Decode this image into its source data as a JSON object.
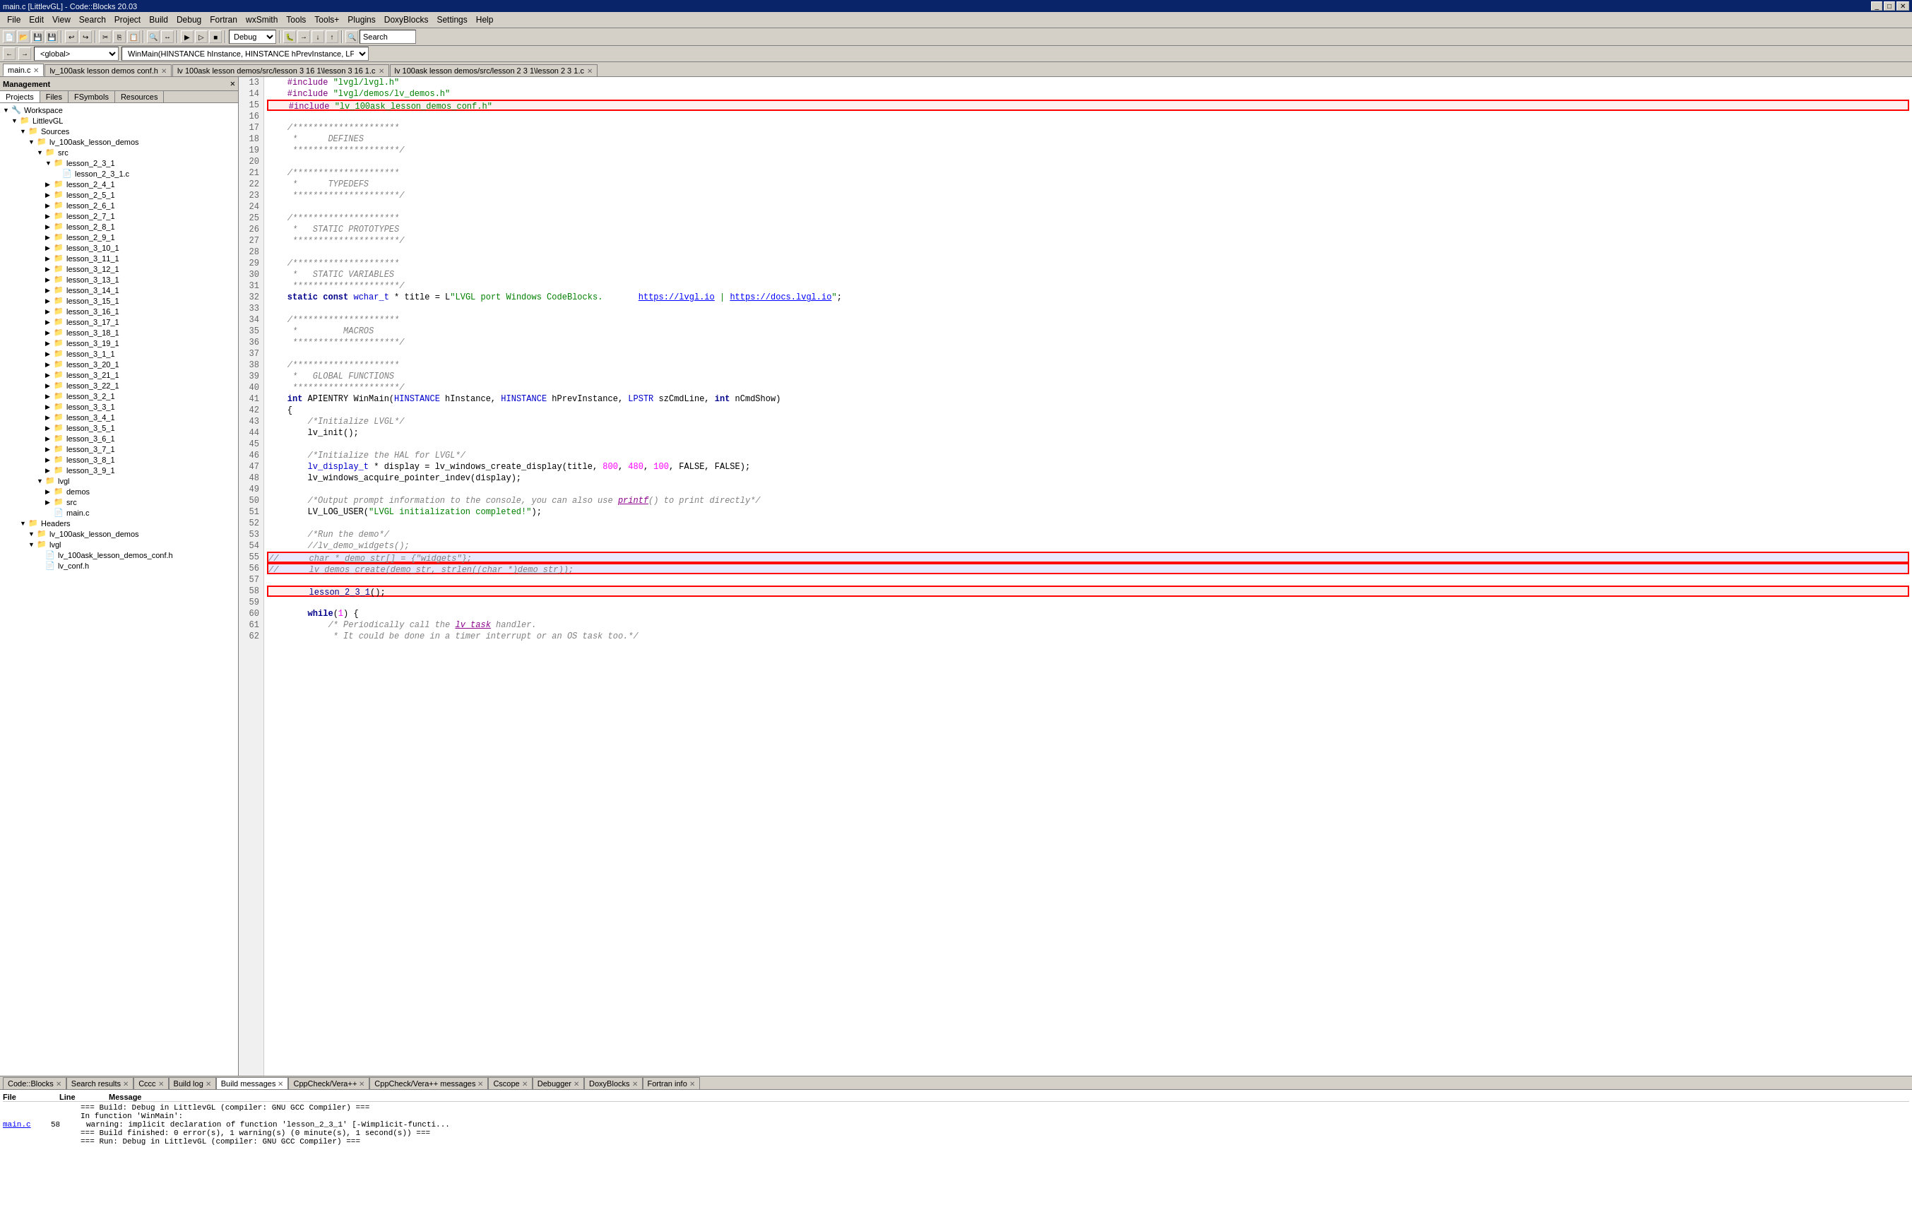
{
  "titleBar": {
    "title": "main.c [LittlevGL] - Code::Blocks 20.03",
    "controls": [
      "_",
      "□",
      "✕"
    ]
  },
  "menuBar": {
    "items": [
      "File",
      "Edit",
      "View",
      "Search",
      "Project",
      "Build",
      "Debug",
      "Fortran",
      "wxSmith",
      "Tools",
      "Tools+",
      "Plugins",
      "DoxyBlocks",
      "Settings",
      "Help"
    ]
  },
  "toolbar": {
    "buildConfig": "Debug",
    "searchLabel": "Search",
    "globalLabel": "<global>",
    "functionLabel": "WinMain(HINSTANCE hInstance, HINSTANCE hPrevInstance, LPSTR szCm▼"
  },
  "tabs": [
    {
      "label": "main.c",
      "active": true,
      "closeable": true
    },
    {
      "label": "lv_100ask lesson demos conf.h",
      "active": false,
      "closeable": true
    },
    {
      "label": "lv 100ask lesson demos/src/lesson 3 16 1\\lesson 3 16 1.c",
      "active": false,
      "closeable": true
    },
    {
      "label": "lv 100ask lesson demos/src/lesson 2 3 1\\lesson 2 3 1.c",
      "active": false,
      "closeable": true
    }
  ],
  "sidebar": {
    "title": "Management",
    "tabs": [
      "Projects",
      "Files",
      "FSymbols",
      "Resources"
    ],
    "activeTab": "Projects",
    "tree": [
      {
        "level": 0,
        "icon": "🔧",
        "label": "Workspace",
        "expanded": true
      },
      {
        "level": 1,
        "icon": "📁",
        "label": "LittlevGL",
        "expanded": true
      },
      {
        "level": 2,
        "icon": "📁",
        "label": "Sources",
        "expanded": true
      },
      {
        "level": 3,
        "icon": "📁",
        "label": "lv_100ask_lesson_demos",
        "expanded": true
      },
      {
        "level": 4,
        "icon": "📁",
        "label": "src",
        "expanded": true
      },
      {
        "level": 5,
        "icon": "📁",
        "label": "lesson_2_3_1",
        "expanded": true
      },
      {
        "level": 6,
        "icon": "📄",
        "label": "lesson_2_3_1.c",
        "expanded": false
      },
      {
        "level": 5,
        "icon": "📁",
        "label": "lesson_2_4_1",
        "expanded": false
      },
      {
        "level": 5,
        "icon": "📁",
        "label": "lesson_2_5_1",
        "expanded": false
      },
      {
        "level": 5,
        "icon": "📁",
        "label": "lesson_2_6_1",
        "expanded": false
      },
      {
        "level": 5,
        "icon": "📁",
        "label": "lesson_2_7_1",
        "expanded": false
      },
      {
        "level": 5,
        "icon": "📁",
        "label": "lesson_2_8_1",
        "expanded": false
      },
      {
        "level": 5,
        "icon": "📁",
        "label": "lesson_2_9_1",
        "expanded": false
      },
      {
        "level": 5,
        "icon": "📁",
        "label": "lesson_3_10_1",
        "expanded": false
      },
      {
        "level": 5,
        "icon": "📁",
        "label": "lesson_3_11_1",
        "expanded": false
      },
      {
        "level": 5,
        "icon": "📁",
        "label": "lesson_3_12_1",
        "expanded": false
      },
      {
        "level": 5,
        "icon": "📁",
        "label": "lesson_3_13_1",
        "expanded": false
      },
      {
        "level": 5,
        "icon": "📁",
        "label": "lesson_3_14_1",
        "expanded": false
      },
      {
        "level": 5,
        "icon": "📁",
        "label": "lesson_3_15_1",
        "expanded": false
      },
      {
        "level": 5,
        "icon": "📁",
        "label": "lesson_3_16_1",
        "expanded": false
      },
      {
        "level": 5,
        "icon": "📁",
        "label": "lesson_3_17_1",
        "expanded": false
      },
      {
        "level": 5,
        "icon": "📁",
        "label": "lesson_3_18_1",
        "expanded": false
      },
      {
        "level": 5,
        "icon": "📁",
        "label": "lesson_3_19_1",
        "expanded": false
      },
      {
        "level": 5,
        "icon": "📁",
        "label": "lesson_3_1_1",
        "expanded": false
      },
      {
        "level": 5,
        "icon": "📁",
        "label": "lesson_3_20_1",
        "expanded": false
      },
      {
        "level": 5,
        "icon": "📁",
        "label": "lesson_3_21_1",
        "expanded": false
      },
      {
        "level": 5,
        "icon": "📁",
        "label": "lesson_3_22_1",
        "expanded": false
      },
      {
        "level": 5,
        "icon": "📁",
        "label": "lesson_3_2_1",
        "expanded": false
      },
      {
        "level": 5,
        "icon": "📁",
        "label": "lesson_3_3_1",
        "expanded": false
      },
      {
        "level": 5,
        "icon": "📁",
        "label": "lesson_3_4_1",
        "expanded": false
      },
      {
        "level": 5,
        "icon": "📁",
        "label": "lesson_3_5_1",
        "expanded": false
      },
      {
        "level": 5,
        "icon": "📁",
        "label": "lesson_3_6_1",
        "expanded": false
      },
      {
        "level": 5,
        "icon": "📁",
        "label": "lesson_3_7_1",
        "expanded": false
      },
      {
        "level": 5,
        "icon": "📁",
        "label": "lesson_3_8_1",
        "expanded": false
      },
      {
        "level": 5,
        "icon": "📁",
        "label": "lesson_3_9_1",
        "expanded": false
      },
      {
        "level": 4,
        "icon": "📁",
        "label": "lvgl",
        "expanded": true
      },
      {
        "level": 5,
        "icon": "📁",
        "label": "demos",
        "expanded": false
      },
      {
        "level": 5,
        "icon": "📁",
        "label": "src",
        "expanded": false
      },
      {
        "level": 5,
        "icon": "📄",
        "label": "main.c",
        "expanded": false
      },
      {
        "level": 3,
        "icon": "📁",
        "label": "Headers",
        "expanded": true
      },
      {
        "level": 4,
        "icon": "📁",
        "label": "lv_100ask_lesson_demos",
        "expanded": true
      },
      {
        "level": 4,
        "icon": "📁",
        "label": "lvgl",
        "expanded": true
      },
      {
        "level": 5,
        "icon": "📄",
        "label": "lv_100ask_lesson_demos_conf.h",
        "expanded": false
      },
      {
        "level": 5,
        "icon": "📄",
        "label": "lv_conf.h",
        "expanded": false
      }
    ]
  },
  "editor": {
    "lines": [
      {
        "num": 13,
        "code": "    #include \"lvgl/lvgl.h\"",
        "type": "normal"
      },
      {
        "num": 14,
        "code": "    #include \"lvgl/demos/lv_demos.h\"",
        "type": "normal"
      },
      {
        "num": 15,
        "code": "    #include \"lv_100ask_lesson_demos_conf.h\"",
        "type": "include-highlight"
      },
      {
        "num": 16,
        "code": "",
        "type": "normal"
      },
      {
        "num": 17,
        "code": "    /*********************",
        "type": "normal"
      },
      {
        "num": 18,
        "code": "     *      DEFINES",
        "type": "normal"
      },
      {
        "num": 19,
        "code": "     *********************/",
        "type": "normal"
      },
      {
        "num": 20,
        "code": "",
        "type": "normal"
      },
      {
        "num": 21,
        "code": "    /*********************",
        "type": "normal"
      },
      {
        "num": 22,
        "code": "     *      TYPEDEFS",
        "type": "normal"
      },
      {
        "num": 23,
        "code": "     *********************/",
        "type": "normal"
      },
      {
        "num": 24,
        "code": "",
        "type": "normal"
      },
      {
        "num": 25,
        "code": "    /*********************",
        "type": "normal"
      },
      {
        "num": 26,
        "code": "     *   STATIC PROTOTYPES",
        "type": "normal"
      },
      {
        "num": 27,
        "code": "     *********************/",
        "type": "normal"
      },
      {
        "num": 28,
        "code": "",
        "type": "normal"
      },
      {
        "num": 29,
        "code": "    /*********************",
        "type": "normal"
      },
      {
        "num": 30,
        "code": "     *   STATIC VARIABLES",
        "type": "normal"
      },
      {
        "num": 31,
        "code": "     *********************/",
        "type": "normal"
      },
      {
        "num": 32,
        "code": "    static const wchar_t * title = L\"LVGL port Windows CodeBlocks.       https://lvgl.io | https://docs.lvgl.io\";",
        "type": "normal"
      },
      {
        "num": 33,
        "code": "",
        "type": "normal"
      },
      {
        "num": 34,
        "code": "    /*********************",
        "type": "normal"
      },
      {
        "num": 35,
        "code": "     *         MACROS",
        "type": "normal"
      },
      {
        "num": 36,
        "code": "     *********************/",
        "type": "normal"
      },
      {
        "num": 37,
        "code": "",
        "type": "normal"
      },
      {
        "num": 38,
        "code": "    /*********************",
        "type": "normal"
      },
      {
        "num": 39,
        "code": "     *   GLOBAL FUNCTIONS",
        "type": "normal"
      },
      {
        "num": 40,
        "code": "     *********************/",
        "type": "normal"
      },
      {
        "num": 41,
        "code": "    int APIENTRY WinMain(HINSTANCE hInstance, HINSTANCE hPrevInstance, LPSTR szCmdLine, int nCmdShow)",
        "type": "normal"
      },
      {
        "num": 42,
        "code": "    {",
        "type": "normal"
      },
      {
        "num": 43,
        "code": "        /*Initialize LVGL*/",
        "type": "normal"
      },
      {
        "num": 44,
        "code": "        lv_init();",
        "type": "normal"
      },
      {
        "num": 45,
        "code": "",
        "type": "normal"
      },
      {
        "num": 46,
        "code": "        /*Initialize the HAL for LVGL*/",
        "type": "normal"
      },
      {
        "num": 47,
        "code": "        lv_display_t * display = lv_windows_create_display(title, 800, 480, 100, FALSE, FALSE);",
        "type": "normal"
      },
      {
        "num": 48,
        "code": "        lv_windows_acquire_pointer_indev(display);",
        "type": "normal"
      },
      {
        "num": 49,
        "code": "",
        "type": "normal"
      },
      {
        "num": 50,
        "code": "        /*Output prompt information to the console, you can also use printf() to print directly*/",
        "type": "normal"
      },
      {
        "num": 51,
        "code": "        LV_LOG_USER(\"LVGL initialization completed!\");",
        "type": "normal"
      },
      {
        "num": 52,
        "code": "",
        "type": "normal"
      },
      {
        "num": 53,
        "code": "        /*Run the demo*/",
        "type": "normal"
      },
      {
        "num": 54,
        "code": "        //lv_demo_widgets();",
        "type": "normal"
      },
      {
        "num": 55,
        "code": "//      char * demo_str[] = {\"widgets\"};",
        "type": "commented-out"
      },
      {
        "num": 56,
        "code": "//      lv_demos_create(demo_str, strlen((char *)demo_str));",
        "type": "commented-out"
      },
      {
        "num": 57,
        "code": "",
        "type": "normal"
      },
      {
        "num": 58,
        "code": "        lesson_2_3_1();",
        "type": "lesson-highlight"
      },
      {
        "num": 59,
        "code": "",
        "type": "normal"
      },
      {
        "num": 60,
        "code": "        while(1) {",
        "type": "normal"
      },
      {
        "num": 61,
        "code": "            /* Periodically call the lv_task handler.",
        "type": "normal"
      },
      {
        "num": 62,
        "code": "             * It could be done in a timer interrupt or an OS task too.*/",
        "type": "normal"
      }
    ]
  },
  "logs": {
    "tabs": [
      "Code::Blocks",
      "Search results",
      "Cccc",
      "Build log",
      "Build messages",
      "CppCheck/Vera++",
      "CppCheck/Vera++ messages",
      "Cscope",
      "Debugger",
      "DoxyBlocks",
      "Fortran info"
    ],
    "activeTab": "Build messages",
    "columns": [
      "File",
      "Line",
      "Message"
    ],
    "rows": [
      {
        "file": "",
        "line": "",
        "msg": "=== Build: Debug in LittlevGL (compiler: GNU GCC Compiler) ==="
      },
      {
        "file": "",
        "line": "",
        "msg": "In function 'WinMain':"
      },
      {
        "file": "main.c",
        "line": "58",
        "msg": "warning: implicit declaration of function 'lesson_2_3_1' [-Wimplicit-functi...",
        "isWarning": true
      },
      {
        "file": "",
        "line": "",
        "msg": "=== Build finished: 0 error(s), 1 warning(s) (0 minute(s), 1 second(s)) ==="
      },
      {
        "file": "",
        "line": "",
        "msg": "=== Run: Debug in LittlevGL (compiler: GNU GCC Compiler) ==="
      }
    ]
  }
}
